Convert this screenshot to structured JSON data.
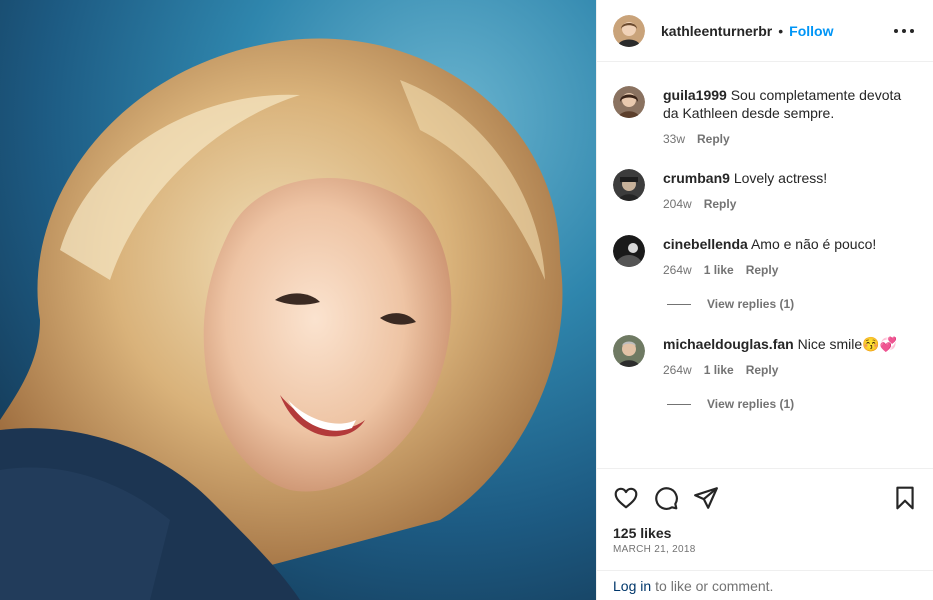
{
  "post": {
    "author": "kathleenturnerbr",
    "separator": "•",
    "follow_label": "Follow",
    "more_icon": "more-options-icon"
  },
  "comments": [
    {
      "user": "guila1999",
      "text": "Sou completamente devota da Kathleen desde sempre.",
      "time": "33w",
      "likes": "",
      "reply": "Reply"
    },
    {
      "user": "crumban9",
      "text": "Lovely actress!",
      "time": "204w",
      "likes": "",
      "reply": "Reply"
    },
    {
      "user": "cinebellenda",
      "text": "Amo e não é pouco!",
      "time": "264w",
      "likes": "1 like",
      "reply": "Reply",
      "view_replies": "View replies (1)"
    },
    {
      "user": "michaeldouglas.fan",
      "text": "Nice smile😚💞",
      "time": "264w",
      "likes": "1 like",
      "reply": "Reply",
      "view_replies": "View replies (1)"
    }
  ],
  "actions": {
    "icons": [
      "heart-icon",
      "comment-icon",
      "share-icon",
      "bookmark-icon"
    ],
    "likes": "125 likes",
    "date": "MARCH 21, 2018"
  },
  "login": {
    "link": "Log in",
    "text": "to like or comment."
  },
  "colors": {
    "accent": "#0095f6",
    "link_dark": "#00376b",
    "secondary_text": "#737373",
    "divider": "#efefef"
  }
}
